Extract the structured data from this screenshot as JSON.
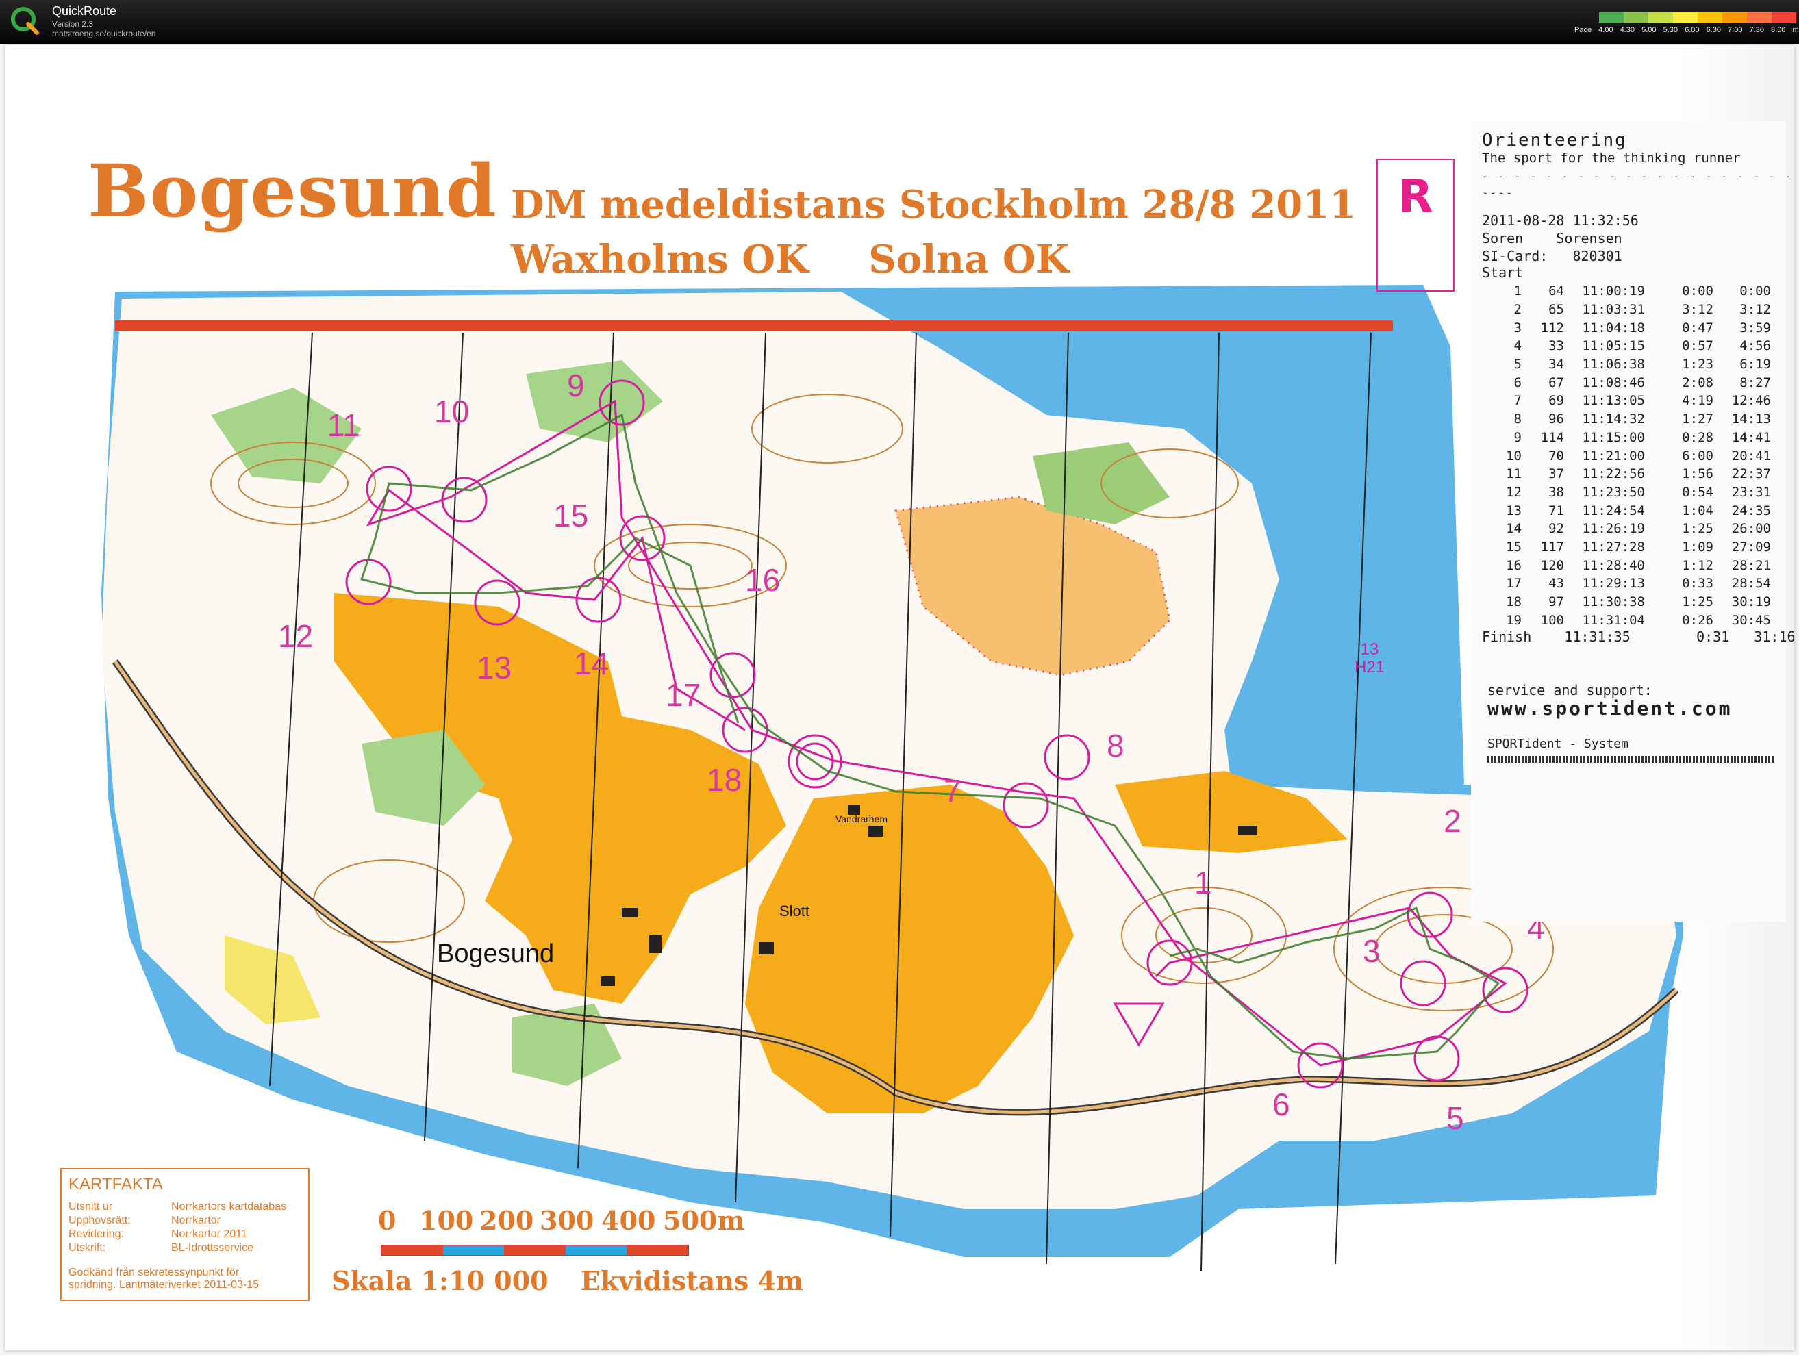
{
  "app": {
    "title": "QuickRoute",
    "version": "Version 2.3",
    "url": "matstroeng.se/quickroute/en"
  },
  "pace_legend": {
    "prefix": "Pace",
    "ticks": [
      "4.00",
      "4.30",
      "5.00",
      "5.30",
      "6.00",
      "6.30",
      "7.00",
      "7.30",
      "8.00"
    ],
    "unit": "min/km",
    "colors": [
      "#4caf50",
      "#8bc34a",
      "#c6e04a",
      "#ffeb3b",
      "#ffc107",
      "#ff9800",
      "#ff7043",
      "#f44336"
    ]
  },
  "map": {
    "title": "Bogesund",
    "event": "DM medeldistans Stockholm 28/8 2011",
    "club1": "Waxholms OK",
    "club2": "Solna OK",
    "course_letter": "R",
    "course_tag": [
      "13",
      "H21"
    ],
    "place_bogesund": "Bogesund",
    "place_slott": "Slott",
    "place_vandrarhem": "Vandrarhem",
    "controls": [
      "1",
      "2",
      "3",
      "4",
      "5",
      "6",
      "7",
      "8",
      "9",
      "10",
      "11",
      "12",
      "13",
      "14",
      "15",
      "16",
      "17",
      "18"
    ],
    "colors": {
      "route": "#d31ea0",
      "title": "#e07a2a",
      "water": "#5fb4e8",
      "open": "#f6ac1a",
      "forest_green": "#a6d488"
    }
  },
  "receipt": {
    "brand": "Orienteering",
    "tagline": "The sport for the thinking runner",
    "short_dash": "----",
    "datetime": "2011-08-28 11:32:56",
    "name": "Soren    Sorensen",
    "si_card": "SI-Card:   820301",
    "start": "Start",
    "rows": [
      {
        "n": "1",
        "code": "64",
        "time": "11:00:19",
        "split": "0:00",
        "acc": "0:00"
      },
      {
        "n": "2",
        "code": "65",
        "time": "11:03:31",
        "split": "3:12",
        "acc": "3:12"
      },
      {
        "n": "3",
        "code": "112",
        "time": "11:04:18",
        "split": "0:47",
        "acc": "3:59"
      },
      {
        "n": "4",
        "code": "33",
        "time": "11:05:15",
        "split": "0:57",
        "acc": "4:56"
      },
      {
        "n": "5",
        "code": "34",
        "time": "11:06:38",
        "split": "1:23",
        "acc": "6:19"
      },
      {
        "n": "6",
        "code": "67",
        "time": "11:08:46",
        "split": "2:08",
        "acc": "8:27"
      },
      {
        "n": "7",
        "code": "69",
        "time": "11:13:05",
        "split": "4:19",
        "acc": "12:46"
      },
      {
        "n": "8",
        "code": "96",
        "time": "11:14:32",
        "split": "1:27",
        "acc": "14:13"
      },
      {
        "n": "9",
        "code": "114",
        "time": "11:15:00",
        "split": "0:28",
        "acc": "14:41"
      },
      {
        "n": "10",
        "code": "70",
        "time": "11:21:00",
        "split": "6:00",
        "acc": "20:41"
      },
      {
        "n": "11",
        "code": "37",
        "time": "11:22:56",
        "split": "1:56",
        "acc": "22:37"
      },
      {
        "n": "12",
        "code": "38",
        "time": "11:23:50",
        "split": "0:54",
        "acc": "23:31"
      },
      {
        "n": "13",
        "code": "71",
        "time": "11:24:54",
        "split": "1:04",
        "acc": "24:35"
      },
      {
        "n": "14",
        "code": "92",
        "time": "11:26:19",
        "split": "1:25",
        "acc": "26:00"
      },
      {
        "n": "15",
        "code": "117",
        "time": "11:27:28",
        "split": "1:09",
        "acc": "27:09"
      },
      {
        "n": "16",
        "code": "120",
        "time": "11:28:40",
        "split": "1:12",
        "acc": "28:21"
      },
      {
        "n": "17",
        "code": "43",
        "time": "11:29:13",
        "split": "0:33",
        "acc": "28:54"
      },
      {
        "n": "18",
        "code": "97",
        "time": "11:30:38",
        "split": "1:25",
        "acc": "30:19"
      },
      {
        "n": "19",
        "code": "100",
        "time": "11:31:04",
        "split": "0:26",
        "acc": "30:45"
      }
    ],
    "finish": "Finish    11:31:35        0:31   31:16",
    "support": "service and support:",
    "website": "www.sportident.com",
    "system": "SPORTident - System"
  },
  "kartfakta": {
    "title": "KARTFAKTA",
    "rows": [
      {
        "k": "Utsnitt ur",
        "v": "Norrkartors kartdatabas"
      },
      {
        "k": "Upphovsrätt:",
        "v": "Norrkartor"
      },
      {
        "k": "Revidering:",
        "v": "Norrkartor 2011"
      },
      {
        "k": "Utskrift:",
        "v": "BL-Idrottsservice"
      }
    ],
    "note1": "Godkänd från sekretessynpunkt för",
    "note2": "spridning. Lantmäteriverket 2011-03-15"
  },
  "scale": {
    "labels": [
      "0",
      "100",
      "200",
      "300",
      "400",
      "500m"
    ],
    "scale": "Skala 1:10 000",
    "contour": "Ekvidistans 4m"
  }
}
